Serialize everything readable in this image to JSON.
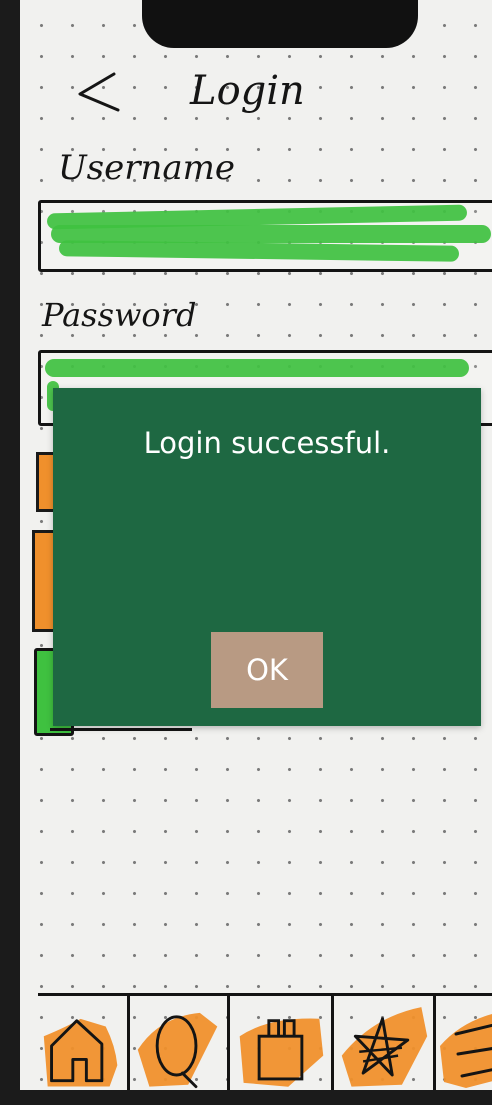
{
  "header": {
    "title": "Login",
    "back_icon": "back-chevron-icon"
  },
  "form": {
    "username_label": "Username",
    "username_value": "",
    "password_label": "Password",
    "password_value": ""
  },
  "dialog": {
    "message": "Login successful.",
    "ok_label": "OK"
  },
  "tabbar": {
    "items": [
      {
        "icon": "home-icon"
      },
      {
        "icon": "search-icon"
      },
      {
        "icon": "bag-icon"
      },
      {
        "icon": "star-icon"
      },
      {
        "icon": "menu-icon"
      }
    ]
  },
  "colors": {
    "paper": "#f1f1ef",
    "marker_green": "#3fc140",
    "marker_orange": "#f0902c",
    "dialog_bg": "#1e6842",
    "ok_button": "#b89a83",
    "ink": "#141414"
  }
}
